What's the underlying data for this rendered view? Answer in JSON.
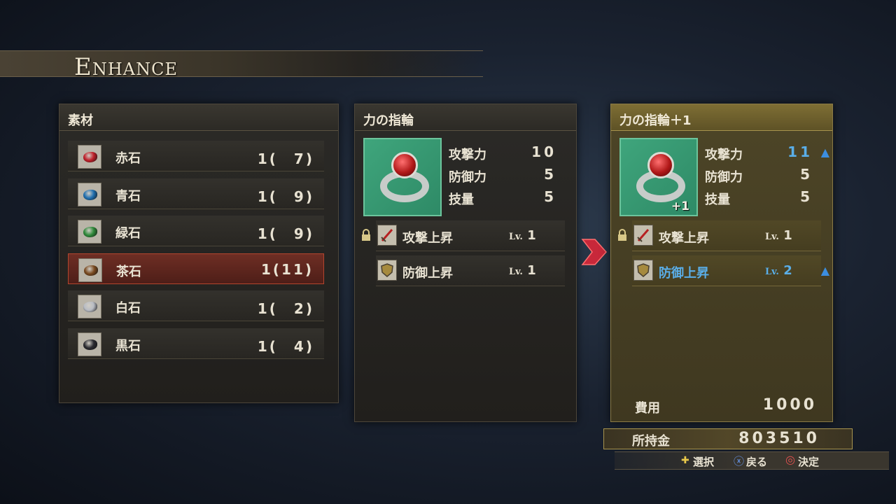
{
  "title": "Enhance",
  "materials_panel": {
    "header": "素材",
    "items": [
      {
        "name": "赤石",
        "qty": "1(　7)",
        "gem_color": "#c0202a"
      },
      {
        "name": "青石",
        "qty": "1(　9)",
        "gem_color": "#1f6fb0"
      },
      {
        "name": "緑石",
        "qty": "1(　9)",
        "gem_color": "#2f8a3a"
      },
      {
        "name": "茶石",
        "qty": "1(11)",
        "gem_color": "#7a4a20"
      },
      {
        "name": "白石",
        "qty": "1(　2)",
        "gem_color": "#b8bcc4"
      },
      {
        "name": "黒石",
        "qty": "1(　4)",
        "gem_color": "#2a2a30"
      }
    ],
    "selected_index": 3
  },
  "current_panel": {
    "header": "力の指輪",
    "stats": [
      {
        "label": "攻撃力",
        "value": "10"
      },
      {
        "label": "防御力",
        "value": "5"
      },
      {
        "label": "技量",
        "value": "5"
      }
    ],
    "skills": [
      {
        "name": "攻撃上昇",
        "lv_prefix": "Lv.",
        "lv": "1",
        "locked": true,
        "icon": "sword-icon"
      },
      {
        "name": "防御上昇",
        "lv_prefix": "Lv.",
        "lv": "1",
        "locked": false,
        "icon": "shield-icon"
      }
    ]
  },
  "result_panel": {
    "header": "力の指輪＋1",
    "plus_label": "+1",
    "stats": [
      {
        "label": "攻撃力",
        "value": "11",
        "up": true
      },
      {
        "label": "防御力",
        "value": "5",
        "up": false
      },
      {
        "label": "技量",
        "value": "5",
        "up": false
      }
    ],
    "skills": [
      {
        "name": "攻撃上昇",
        "lv_prefix": "Lv.",
        "lv": "1",
        "locked": true,
        "up": false,
        "icon": "sword-icon"
      },
      {
        "name": "防御上昇",
        "lv_prefix": "Lv.",
        "lv": "2",
        "locked": false,
        "up": true,
        "icon": "shield-icon"
      }
    ],
    "cost_label": "費用",
    "cost_value": "1000"
  },
  "funds": {
    "label": "所持金",
    "value": "803510"
  },
  "controls": {
    "select": "選択",
    "back": "戻る",
    "confirm": "決定"
  },
  "colors": {
    "highlight_blue": "#5aaee8",
    "selected_row": "#6e2e24",
    "arrow": "#d0303a"
  }
}
